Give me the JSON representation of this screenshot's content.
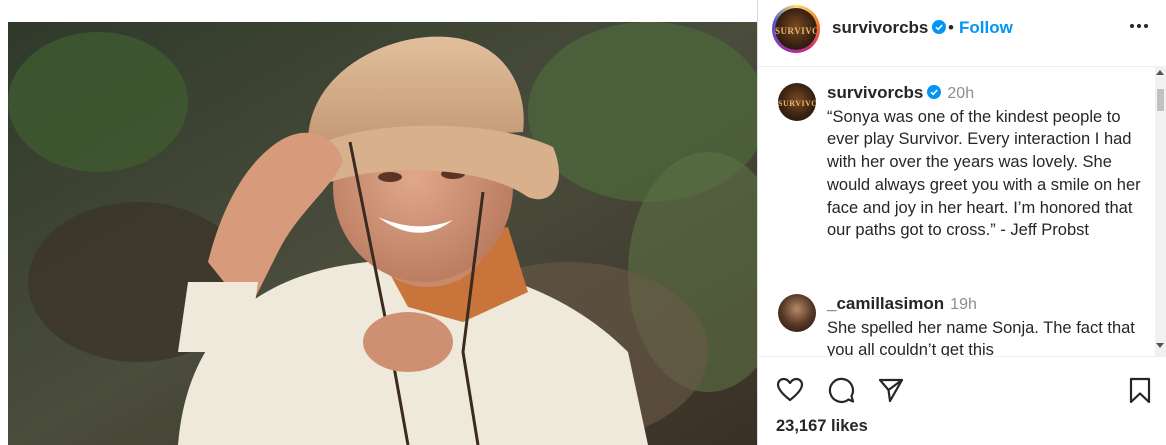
{
  "post": {
    "username": "survivorcbs",
    "dot": "•",
    "follow_label": "Follow",
    "avatar_text": "SURVIVOR"
  },
  "caption": {
    "username": "survivorcbs",
    "time": "20h",
    "text": "“Sonya was one of the kindest people to ever play Survivor. Every interaction I had with her over the years was lovely. She would always greet you with a smile on her face and joy in her heart. I’m honored that our paths got to cross.” - Jeff Probst"
  },
  "comments": [
    {
      "username": "_camillasimon",
      "time": "19h",
      "text": "She spelled her name Sonja. The fact that you all couldn’t get this"
    }
  ],
  "likes": "23,167 likes",
  "colors": {
    "follow": "#0095f6",
    "verified": "#0095f6",
    "text": "#262626",
    "muted": "#8e8e8e"
  },
  "icons": [
    "verified-badge-icon",
    "more-options-icon",
    "heart-icon",
    "comment-icon",
    "share-icon",
    "bookmark-icon"
  ]
}
